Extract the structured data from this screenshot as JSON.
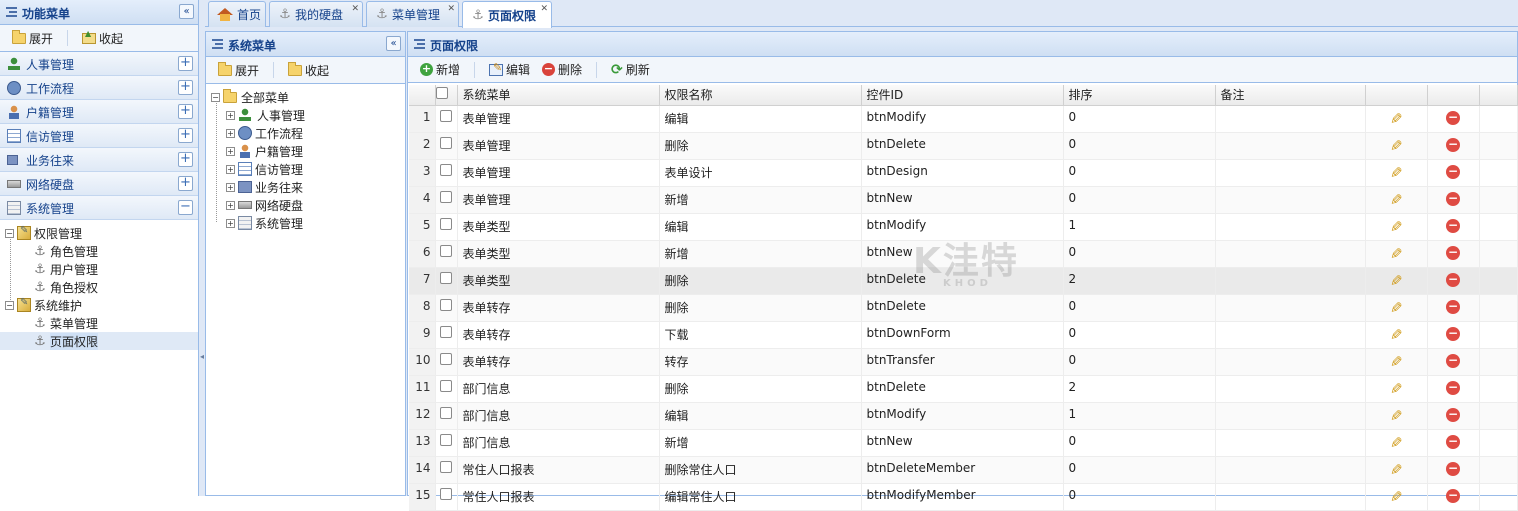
{
  "left_panel": {
    "title": "功能菜单",
    "expand_label": "展开",
    "collapse_label": "收起",
    "modules": [
      {
        "label": "人事管理",
        "icon": "people-icon"
      },
      {
        "label": "工作流程",
        "icon": "workflow-icon"
      },
      {
        "label": "户籍管理",
        "icon": "person-icon"
      },
      {
        "label": "信访管理",
        "icon": "document-icon"
      },
      {
        "label": "业务往来",
        "icon": "square-icon"
      },
      {
        "label": "网络硬盘",
        "icon": "disk-icon"
      },
      {
        "label": "系统管理",
        "icon": "system-icon"
      }
    ],
    "tree": {
      "group1": {
        "label": "权限管理",
        "children": [
          "角色管理",
          "用户管理",
          "角色授权"
        ]
      },
      "group2": {
        "label": "系统维护",
        "children": [
          "菜单管理",
          "页面权限"
        ]
      }
    }
  },
  "tabs": [
    {
      "label": "首页"
    },
    {
      "label": "我的硬盘"
    },
    {
      "label": "菜单管理"
    },
    {
      "label": "页面权限"
    }
  ],
  "sys_menu": {
    "title": "系统菜单",
    "expand_label": "展开",
    "collapse_label": "收起",
    "root": "全部菜单",
    "items": [
      "人事管理",
      "工作流程",
      "户籍管理",
      "信访管理",
      "业务往来",
      "网络硬盘",
      "系统管理"
    ]
  },
  "grid": {
    "title": "页面权限",
    "toolbar": {
      "add": "新增",
      "edit": "编辑",
      "delete": "删除",
      "refresh": "刷新"
    },
    "columns": [
      "系统菜单",
      "权限名称",
      "控件ID",
      "排序",
      "备注"
    ],
    "rows": [
      {
        "n": "1",
        "menu": "表单管理",
        "perm": "编辑",
        "ctrl": "btnModify",
        "sort": "0",
        "note": ""
      },
      {
        "n": "2",
        "menu": "表单管理",
        "perm": "删除",
        "ctrl": "btnDelete",
        "sort": "0",
        "note": ""
      },
      {
        "n": "3",
        "menu": "表单管理",
        "perm": "表单设计",
        "ctrl": "btnDesign",
        "sort": "0",
        "note": ""
      },
      {
        "n": "4",
        "menu": "表单管理",
        "perm": "新增",
        "ctrl": "btnNew",
        "sort": "0",
        "note": ""
      },
      {
        "n": "5",
        "menu": "表单类型",
        "perm": "编辑",
        "ctrl": "btnModify",
        "sort": "1",
        "note": ""
      },
      {
        "n": "6",
        "menu": "表单类型",
        "perm": "新增",
        "ctrl": "btnNew",
        "sort": "0",
        "note": ""
      },
      {
        "n": "7",
        "menu": "表单类型",
        "perm": "删除",
        "ctrl": "btnDelete",
        "sort": "2",
        "note": ""
      },
      {
        "n": "8",
        "menu": "表单转存",
        "perm": "删除",
        "ctrl": "btnDelete",
        "sort": "0",
        "note": ""
      },
      {
        "n": "9",
        "menu": "表单转存",
        "perm": "下载",
        "ctrl": "btnDownForm",
        "sort": "0",
        "note": ""
      },
      {
        "n": "10",
        "menu": "表单转存",
        "perm": "转存",
        "ctrl": "btnTransfer",
        "sort": "0",
        "note": ""
      },
      {
        "n": "11",
        "menu": "部门信息",
        "perm": "删除",
        "ctrl": "btnDelete",
        "sort": "2",
        "note": ""
      },
      {
        "n": "12",
        "menu": "部门信息",
        "perm": "编辑",
        "ctrl": "btnModify",
        "sort": "1",
        "note": ""
      },
      {
        "n": "13",
        "menu": "部门信息",
        "perm": "新增",
        "ctrl": "btnNew",
        "sort": "0",
        "note": ""
      },
      {
        "n": "14",
        "menu": "常住人口报表",
        "perm": "删除常住人口",
        "ctrl": "btnDeleteMember",
        "sort": "0",
        "note": ""
      },
      {
        "n": "15",
        "menu": "常住人口报表",
        "perm": "编辑常住人口",
        "ctrl": "btnModifyMember",
        "sort": "0",
        "note": ""
      }
    ]
  },
  "watermark": {
    "main": "K洼特",
    "sub": "KHOD"
  }
}
